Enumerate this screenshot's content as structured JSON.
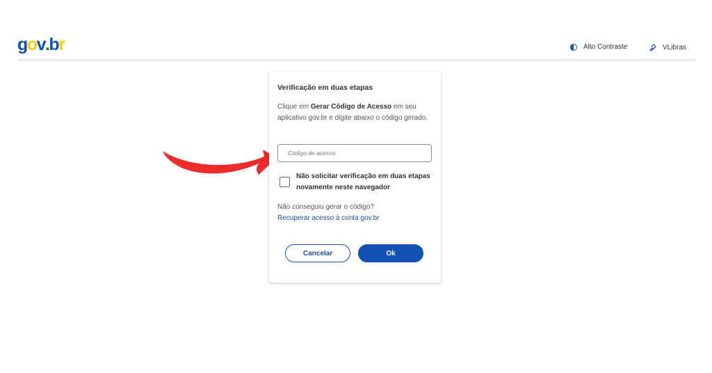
{
  "header": {
    "logo": {
      "g": "g",
      "o": "o",
      "v": "v",
      "dot": ".",
      "b": "b",
      "r": "r"
    },
    "high_contrast_label": "Alto Contraste",
    "vlibras_label": "VLibras",
    "brand_colors": {
      "blue": "#1351b4",
      "yellow": "#ffcd07",
      "green": "#168821"
    }
  },
  "dialog": {
    "title": "Verificação em duas etapas",
    "description_prefix": "Clique em ",
    "description_bold": "Gerar Código de Acesso",
    "description_suffix": " em seu aplicativo gov.br e digite abaixo o código gerado.",
    "code_input": {
      "placeholder": "Código de acesso",
      "value": ""
    },
    "remember_checkbox": {
      "label": "Não solicitar verificação em duas etapas novamente neste navegador",
      "checked": false
    },
    "help_text": "Não conseguiu gerar o código?",
    "recover_link": "Recuperar acesso à conta gov.br",
    "cancel_label": "Cancelar",
    "ok_label": "Ok"
  },
  "annotation": {
    "arrow_color": "#ee2a2a",
    "icon": "red-arrow-icon"
  }
}
